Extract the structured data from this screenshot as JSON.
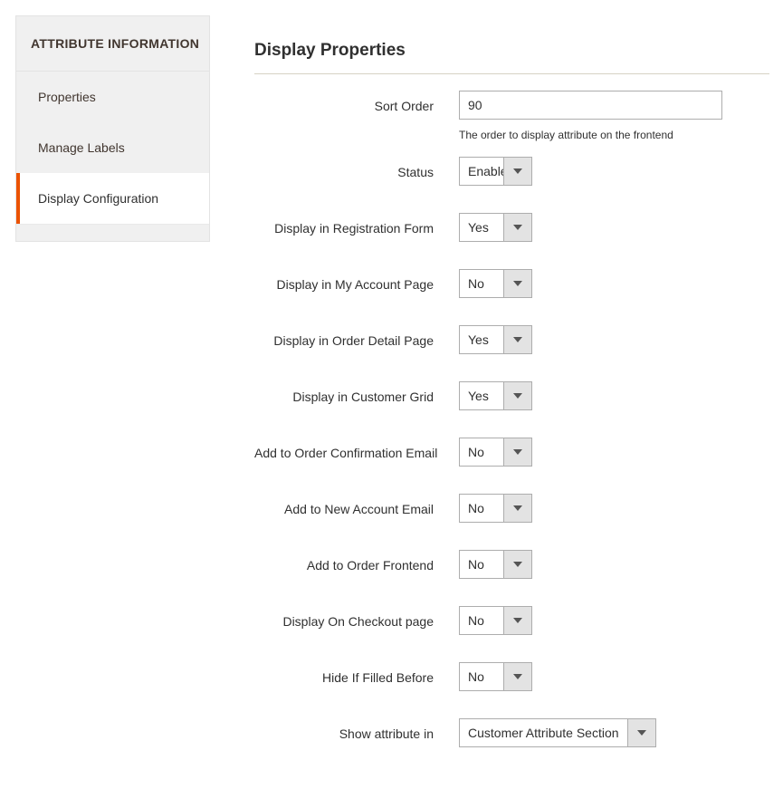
{
  "sidebar": {
    "header": "ATTRIBUTE INFORMATION",
    "items": [
      {
        "label": "Properties",
        "active": false
      },
      {
        "label": "Manage Labels",
        "active": false
      },
      {
        "label": "Display Configuration",
        "active": true
      }
    ]
  },
  "main": {
    "section_title": "Display Properties",
    "fields": [
      {
        "label": "Sort Order",
        "type": "text",
        "value": "90",
        "note": "The order to display attribute on the frontend"
      },
      {
        "label": "Status",
        "type": "select",
        "value": "Enable",
        "width": "small"
      },
      {
        "label": "Display in Registration Form",
        "type": "select",
        "value": "Yes",
        "width": "small"
      },
      {
        "label": "Display in My Account Page",
        "type": "select",
        "value": "No",
        "width": "small"
      },
      {
        "label": "Display in Order Detail Page",
        "type": "select",
        "value": "Yes",
        "width": "small"
      },
      {
        "label": "Display in Customer Grid",
        "type": "select",
        "value": "Yes",
        "width": "small"
      },
      {
        "label": "Add to Order Confirmation Email",
        "type": "select",
        "value": "No",
        "width": "small"
      },
      {
        "label": "Add to New Account Email",
        "type": "select",
        "value": "No",
        "width": "small"
      },
      {
        "label": "Add to Order Frontend",
        "type": "select",
        "value": "No",
        "width": "small"
      },
      {
        "label": "Display On Checkout page",
        "type": "select",
        "value": "No",
        "width": "small"
      },
      {
        "label": "Hide If Filled Before",
        "type": "select",
        "value": "No",
        "width": "small"
      },
      {
        "label": "Show attribute in",
        "type": "select",
        "value": "Customer Attribute Section",
        "width": "wide"
      }
    ]
  },
  "colors": {
    "accent": "#eb5202",
    "sidebar_bg": "#f0f0f0",
    "border": "#adadad",
    "text": "#303030",
    "divider": "#d6d2c4"
  }
}
